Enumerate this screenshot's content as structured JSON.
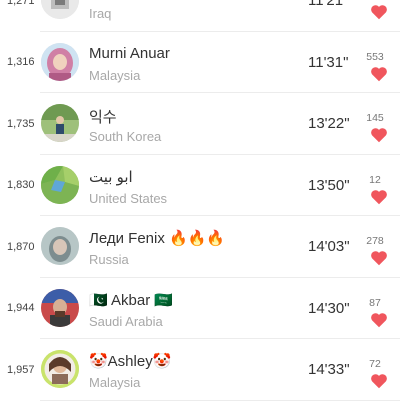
{
  "colors": {
    "heart": "#f0565d",
    "separator": "#ececec",
    "accent_ring": "#c9e36b"
  },
  "leaderboard": [
    {
      "rank": "1,271",
      "name": "",
      "country": "Iraq",
      "time": "11'21\"",
      "likes": "",
      "avatar_icon": "photo-avatar-icon"
    },
    {
      "rank": "1,316",
      "name": "Murni Anuar",
      "country": "Malaysia",
      "time": "11'31\"",
      "likes": "553",
      "avatar_icon": "hijab-avatar-icon"
    },
    {
      "rank": "1,735",
      "name": "익수",
      "country": "South Korea",
      "time": "13'22\"",
      "likes": "145",
      "avatar_icon": "outdoor-avatar-icon"
    },
    {
      "rank": "1,830",
      "name": "ابو بيت",
      "country": "United States",
      "time": "13'50\"",
      "likes": "12",
      "avatar_icon": "map-avatar-icon"
    },
    {
      "rank": "1,870",
      "name": "Леди Fenix 🔥🔥🔥",
      "country": "Russia",
      "time": "14'03\"",
      "likes": "278",
      "avatar_icon": "portrait-avatar-icon"
    },
    {
      "rank": "1,944",
      "name": "🇵🇰 Akbar 🇸🇦",
      "country": "Saudi Arabia",
      "time": "14'30\"",
      "likes": "87",
      "avatar_icon": "man-avatar-icon"
    },
    {
      "rank": "1,957",
      "name": "🤡Ashley🤡",
      "country": "Malaysia",
      "time": "14'33\"",
      "likes": "72",
      "avatar_icon": "selfie-avatar-icon"
    }
  ]
}
